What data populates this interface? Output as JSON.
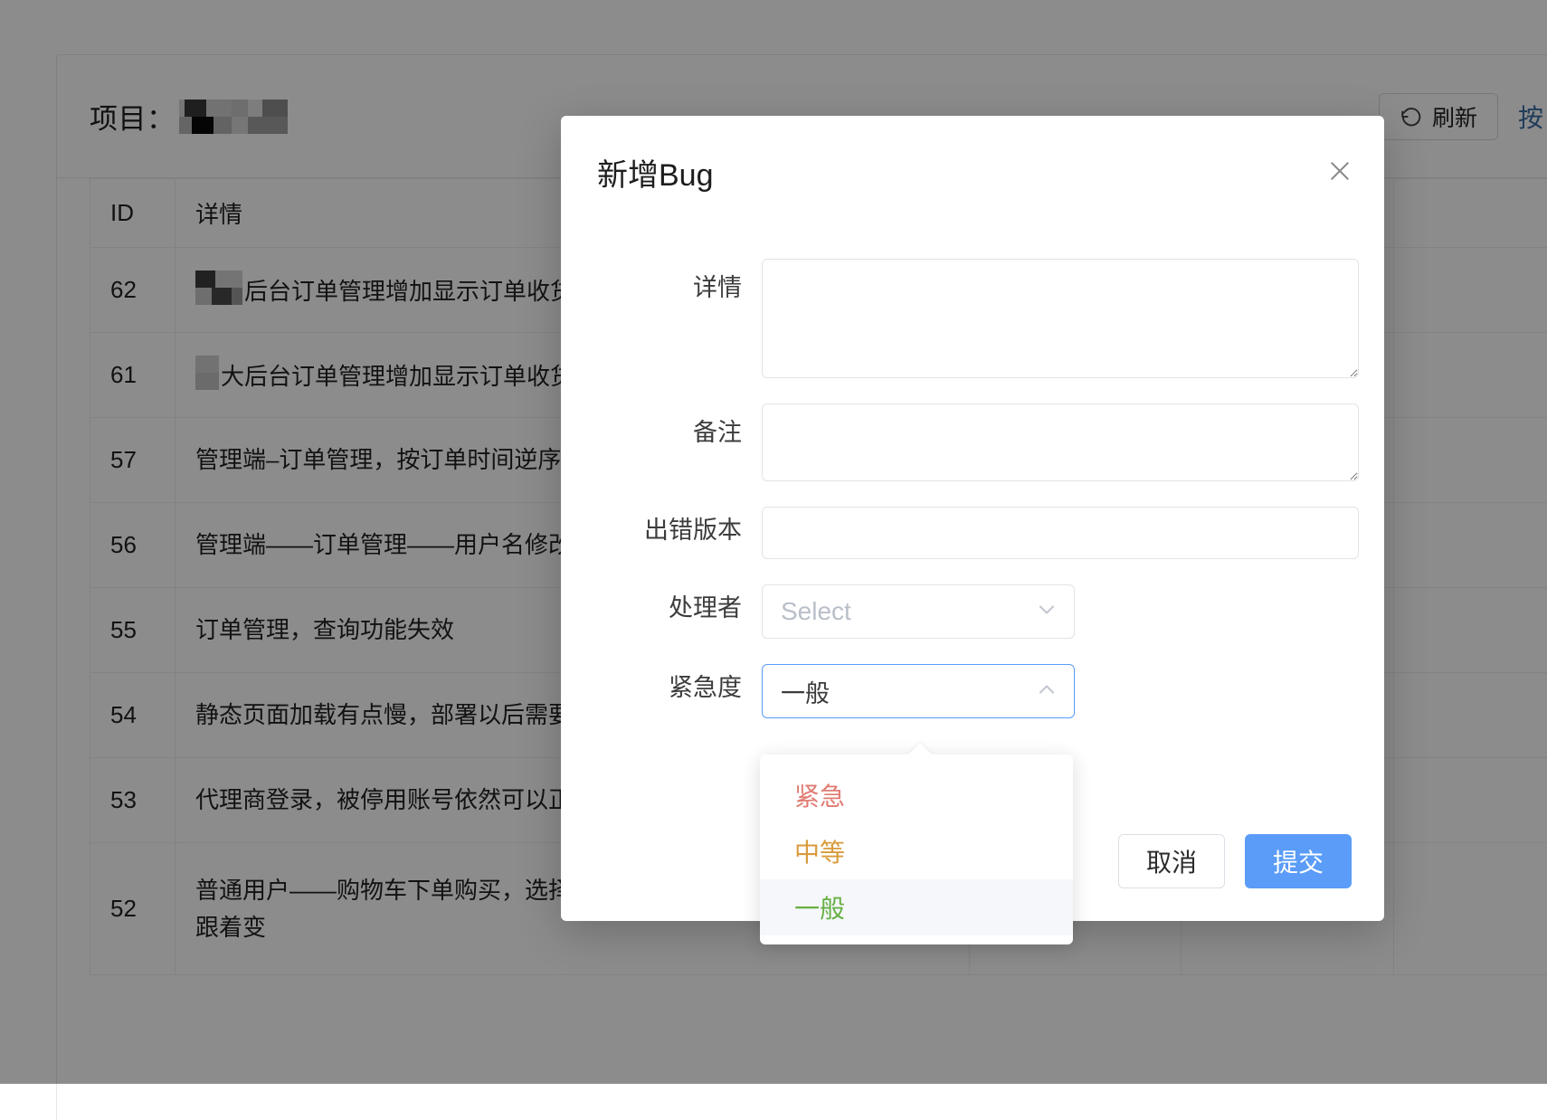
{
  "page": {
    "project_label": "项目：",
    "project_name_redacted": true,
    "refresh_button": "刷新",
    "refresh_icon": "refresh-arrow-icon",
    "side_link": "按"
  },
  "table": {
    "columns": [
      "ID",
      "详情"
    ],
    "rows": [
      {
        "id": "62",
        "detail": "后台订单管理增加显示订单收货地址",
        "redacted_prefix": "dark",
        "tall": false
      },
      {
        "id": "61",
        "detail": "大后台订单管理增加显示订单收货地址",
        "redacted_prefix": "light",
        "tall": false
      },
      {
        "id": "57",
        "detail": "管理端–订单管理，按订单时间逆序排序",
        "redacted_prefix": "none",
        "tall": false
      },
      {
        "id": "56",
        "detail": "管理端——订单管理——用户名修改为收",
        "redacted_prefix": "none",
        "tall": false
      },
      {
        "id": "55",
        "detail": "订单管理，查询功能失效",
        "redacted_prefix": "none",
        "tall": false
      },
      {
        "id": "54",
        "detail": "静态页面加载有点慢，部署以后需要测试",
        "redacted_prefix": "none",
        "tall": false
      },
      {
        "id": "53",
        "detail": "代理商登录，被停用账号依然可以正常登",
        "redacted_prefix": "none",
        "tall": false
      },
      {
        "id": "52",
        "detail": "普通用户——购物车下单购买，选择收货\n跟着变",
        "redacted_prefix": "none",
        "tall": true
      }
    ]
  },
  "modal": {
    "title": "新增Bug",
    "close_icon": "close-x-icon",
    "fields": {
      "detail_label": "详情",
      "detail_value": "",
      "detail_placeholder": "",
      "note_label": "备注",
      "note_value": "",
      "note_placeholder": "",
      "version_label": "出错版本",
      "version_value": "",
      "version_placeholder": "",
      "assignee_label": "处理者",
      "assignee_value": "",
      "assignee_placeholder": "Select",
      "assignee_chevron": "chevron-down-icon",
      "priority_label": "紧急度",
      "priority_value": "一般",
      "priority_chevron": "chevron-up-icon"
    },
    "priority_options": [
      {
        "label": "紧急",
        "color": "#e07b72",
        "selected": false
      },
      {
        "label": "中等",
        "color": "#d89b3c",
        "selected": false
      },
      {
        "label": "一般",
        "color": "#67b044",
        "selected": true
      }
    ],
    "footer": {
      "cancel_label": "取消",
      "submit_label": "提交"
    }
  },
  "colors": {
    "primary": "#5a9cf8",
    "link": "#3b6ea5",
    "urgent": "#e07b72",
    "medium": "#d89b3c",
    "normal": "#67b044",
    "border": "#e0e3e8",
    "overlay": "rgba(0,0,0,0.45)"
  }
}
